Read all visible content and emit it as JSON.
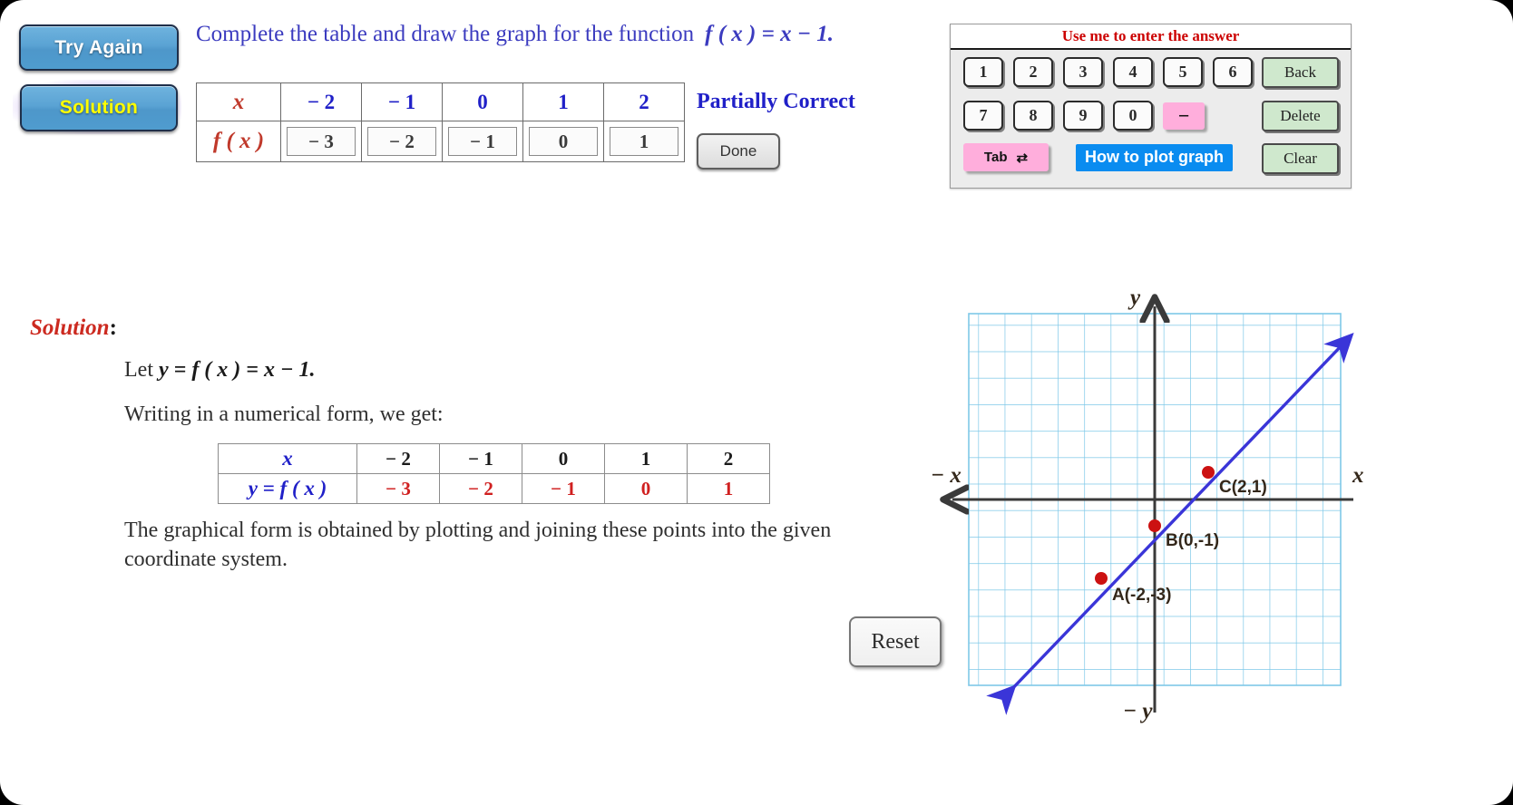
{
  "buttons": {
    "try_again": "Try Again",
    "solution": "Solution",
    "done": "Done",
    "reset": "Reset"
  },
  "prompt": {
    "text": "Complete the table and draw the graph for the function",
    "function": "f ( x )  =  x  −  1."
  },
  "status": {
    "label": "Partially Correct"
  },
  "answer_table": {
    "row_labels": [
      "x",
      "f ( x )"
    ],
    "x_values": [
      "− 2",
      "− 1",
      "0",
      "1",
      "2"
    ],
    "fx_values": [
      "− 3",
      "− 2",
      "− 1",
      "0",
      "1"
    ]
  },
  "keypad": {
    "title": "Use me to enter the answer",
    "row1": [
      "1",
      "2",
      "3",
      "4",
      "5",
      "6"
    ],
    "row2": [
      "7",
      "8",
      "9",
      "0"
    ],
    "minus": "−",
    "tab": "Tab",
    "tab_icon": "⇄",
    "plot_help": "How to plot graph",
    "back": "Back",
    "delete": "Delete",
    "clear": "Clear"
  },
  "solution": {
    "heading": "Solution",
    "heading_colon": ":",
    "let_prefix": "Let ",
    "let_equation": "y  =  f ( x )  =  x  −  1.",
    "writing_line": "Writing in a numerical form, we get:",
    "paragraph": "The graphical form is obtained by plotting and joining these points into the given coordinate system.",
    "table": {
      "row1_label": "x",
      "row2_label": "y  = f ( x )",
      "x_values": [
        "− 2",
        "− 1",
        "0",
        "1",
        "2"
      ],
      "y_values": [
        "− 3",
        "− 2",
        "− 1",
        "0",
        "1"
      ]
    }
  },
  "graph": {
    "axis_labels": {
      "y_positive": "y",
      "y_negative": "− y",
      "x_positive": "x",
      "x_negative": "− x"
    },
    "point_labels": [
      "A(-2,-3)",
      "B(0,-1)",
      "C(2,1)"
    ],
    "colors": {
      "grid": "#7ec8e8",
      "axis": "#3a3a3a",
      "line": "#3a35d8",
      "point": "#cc1111",
      "label": "#33271a"
    }
  },
  "chart_data": {
    "type": "line",
    "title": "",
    "xlabel": "x",
    "ylabel": "y",
    "function": "f(x) = x - 1",
    "x": [
      -2,
      -1,
      0,
      1,
      2
    ],
    "values": [
      -3,
      -2,
      -1,
      0,
      1
    ],
    "points": [
      {
        "name": "A",
        "x": -2,
        "y": -3,
        "label": "A(-2,-3)"
      },
      {
        "name": "B",
        "x": 0,
        "y": -1,
        "label": "B(0,-1)"
      },
      {
        "name": "C",
        "x": 2,
        "y": 1,
        "label": "C(2,1)"
      }
    ],
    "xlim": [
      -7,
      7
    ],
    "ylim": [
      -7,
      7
    ],
    "grid": true,
    "legend": "none"
  }
}
